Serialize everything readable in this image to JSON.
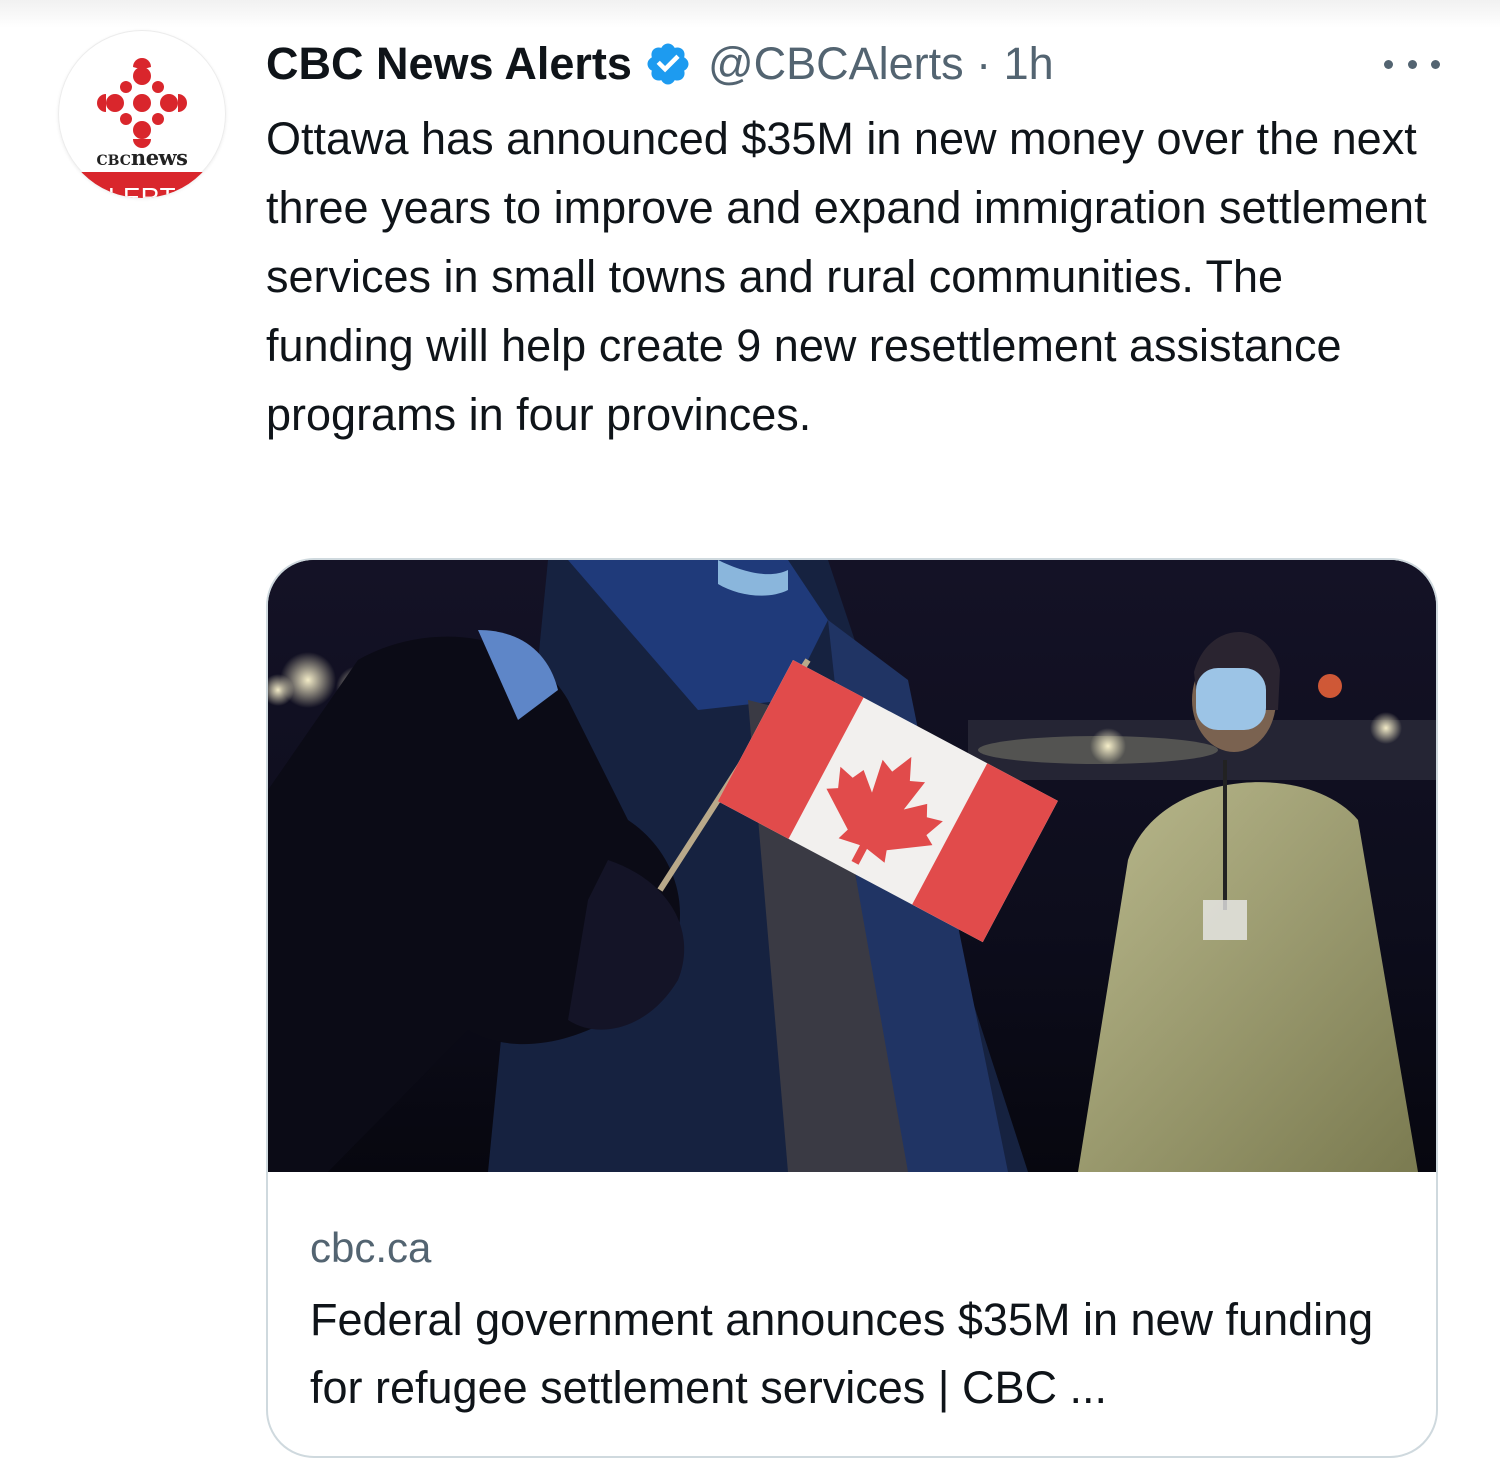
{
  "tweet": {
    "author_name": "CBC News Alerts",
    "handle_time": "@CBCAlerts · 1h",
    "text": "Ottawa has announced $35M in new money over the next three years to improve and expand immigration settlement services in small towns and rural communities. The funding will help create 9 new resettlement assistance programs in four provinces.",
    "avatar": {
      "brand_prefix": "CBC",
      "brand_word": "news",
      "band_text": "ALERTS"
    },
    "icons": {
      "verified": "verified-badge-icon",
      "more": "more-options-icon",
      "logo": "cbc-gem-logo"
    }
  },
  "card": {
    "domain": "cbc.ca",
    "title": "Federal government announces $35M in new funding for refugee settlement services | CBC ..."
  },
  "colors": {
    "verified_blue": "#1d9bf0",
    "secondary_text": "#536471",
    "cbc_red": "#d9262c",
    "card_border": "#cfd9de"
  }
}
